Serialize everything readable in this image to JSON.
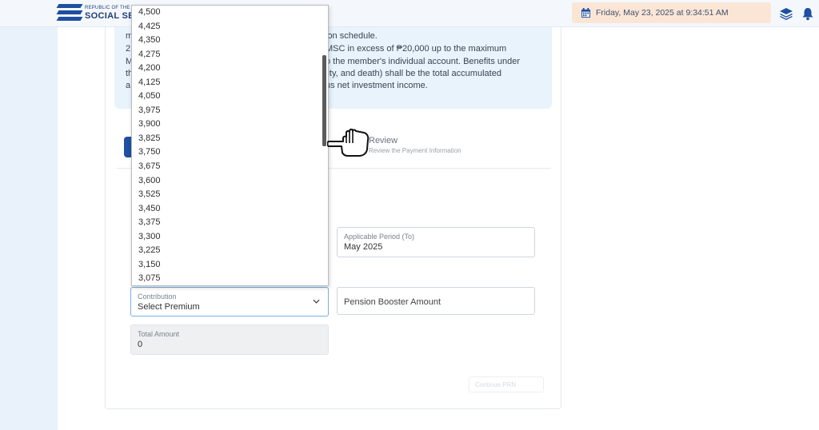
{
  "header": {
    "logo_small": "REPUBLIC OF THE",
    "logo_big": "SOCIAL SEC",
    "datetime": "Friday, May 23, 2025 at 9:34:51 AM"
  },
  "notice": {
    "lines": [
      {
        "left": "m",
        "right": "ion schedule."
      },
      {
        "left": "2.",
        "right": "MSC in excess of ₱20,000 up to the maximum"
      },
      {
        "left": "M",
        "right": "o the member's individual account. Benefits under"
      },
      {
        "left": "th",
        "right": "lity, and death) shall be the total accumulated"
      },
      {
        "left": "a",
        "right": "us net investment income."
      }
    ]
  },
  "steps": {
    "review_title": "Review",
    "review_subtitle": "Review the Payment Information"
  },
  "form": {
    "period_to_label": "Applicable Period (To)",
    "period_to_value": "May 2025",
    "contribution_label": "Contribution",
    "contribution_value": "Select Premium",
    "booster_placeholder": "Pension Booster Amount",
    "total_label": "Total Amount",
    "total_value": "0",
    "continue_label": "Continue PRN"
  },
  "dropdown": {
    "options": [
      "4,500",
      "4,425",
      "4,350",
      "4,275",
      "4,200",
      "4,125",
      "4,050",
      "3,975",
      "3,900",
      "3,825",
      "3,750",
      "3,675",
      "3,600",
      "3,525",
      "3,450",
      "3,375",
      "3,300",
      "3,225",
      "3,150",
      "3,075"
    ]
  },
  "colors": {
    "brand_blue": "#1f4fa0",
    "date_bg": "#fbe6d6",
    "notice_bg": "#e8f3fc",
    "sidebar_bg": "#e9f1fb"
  }
}
